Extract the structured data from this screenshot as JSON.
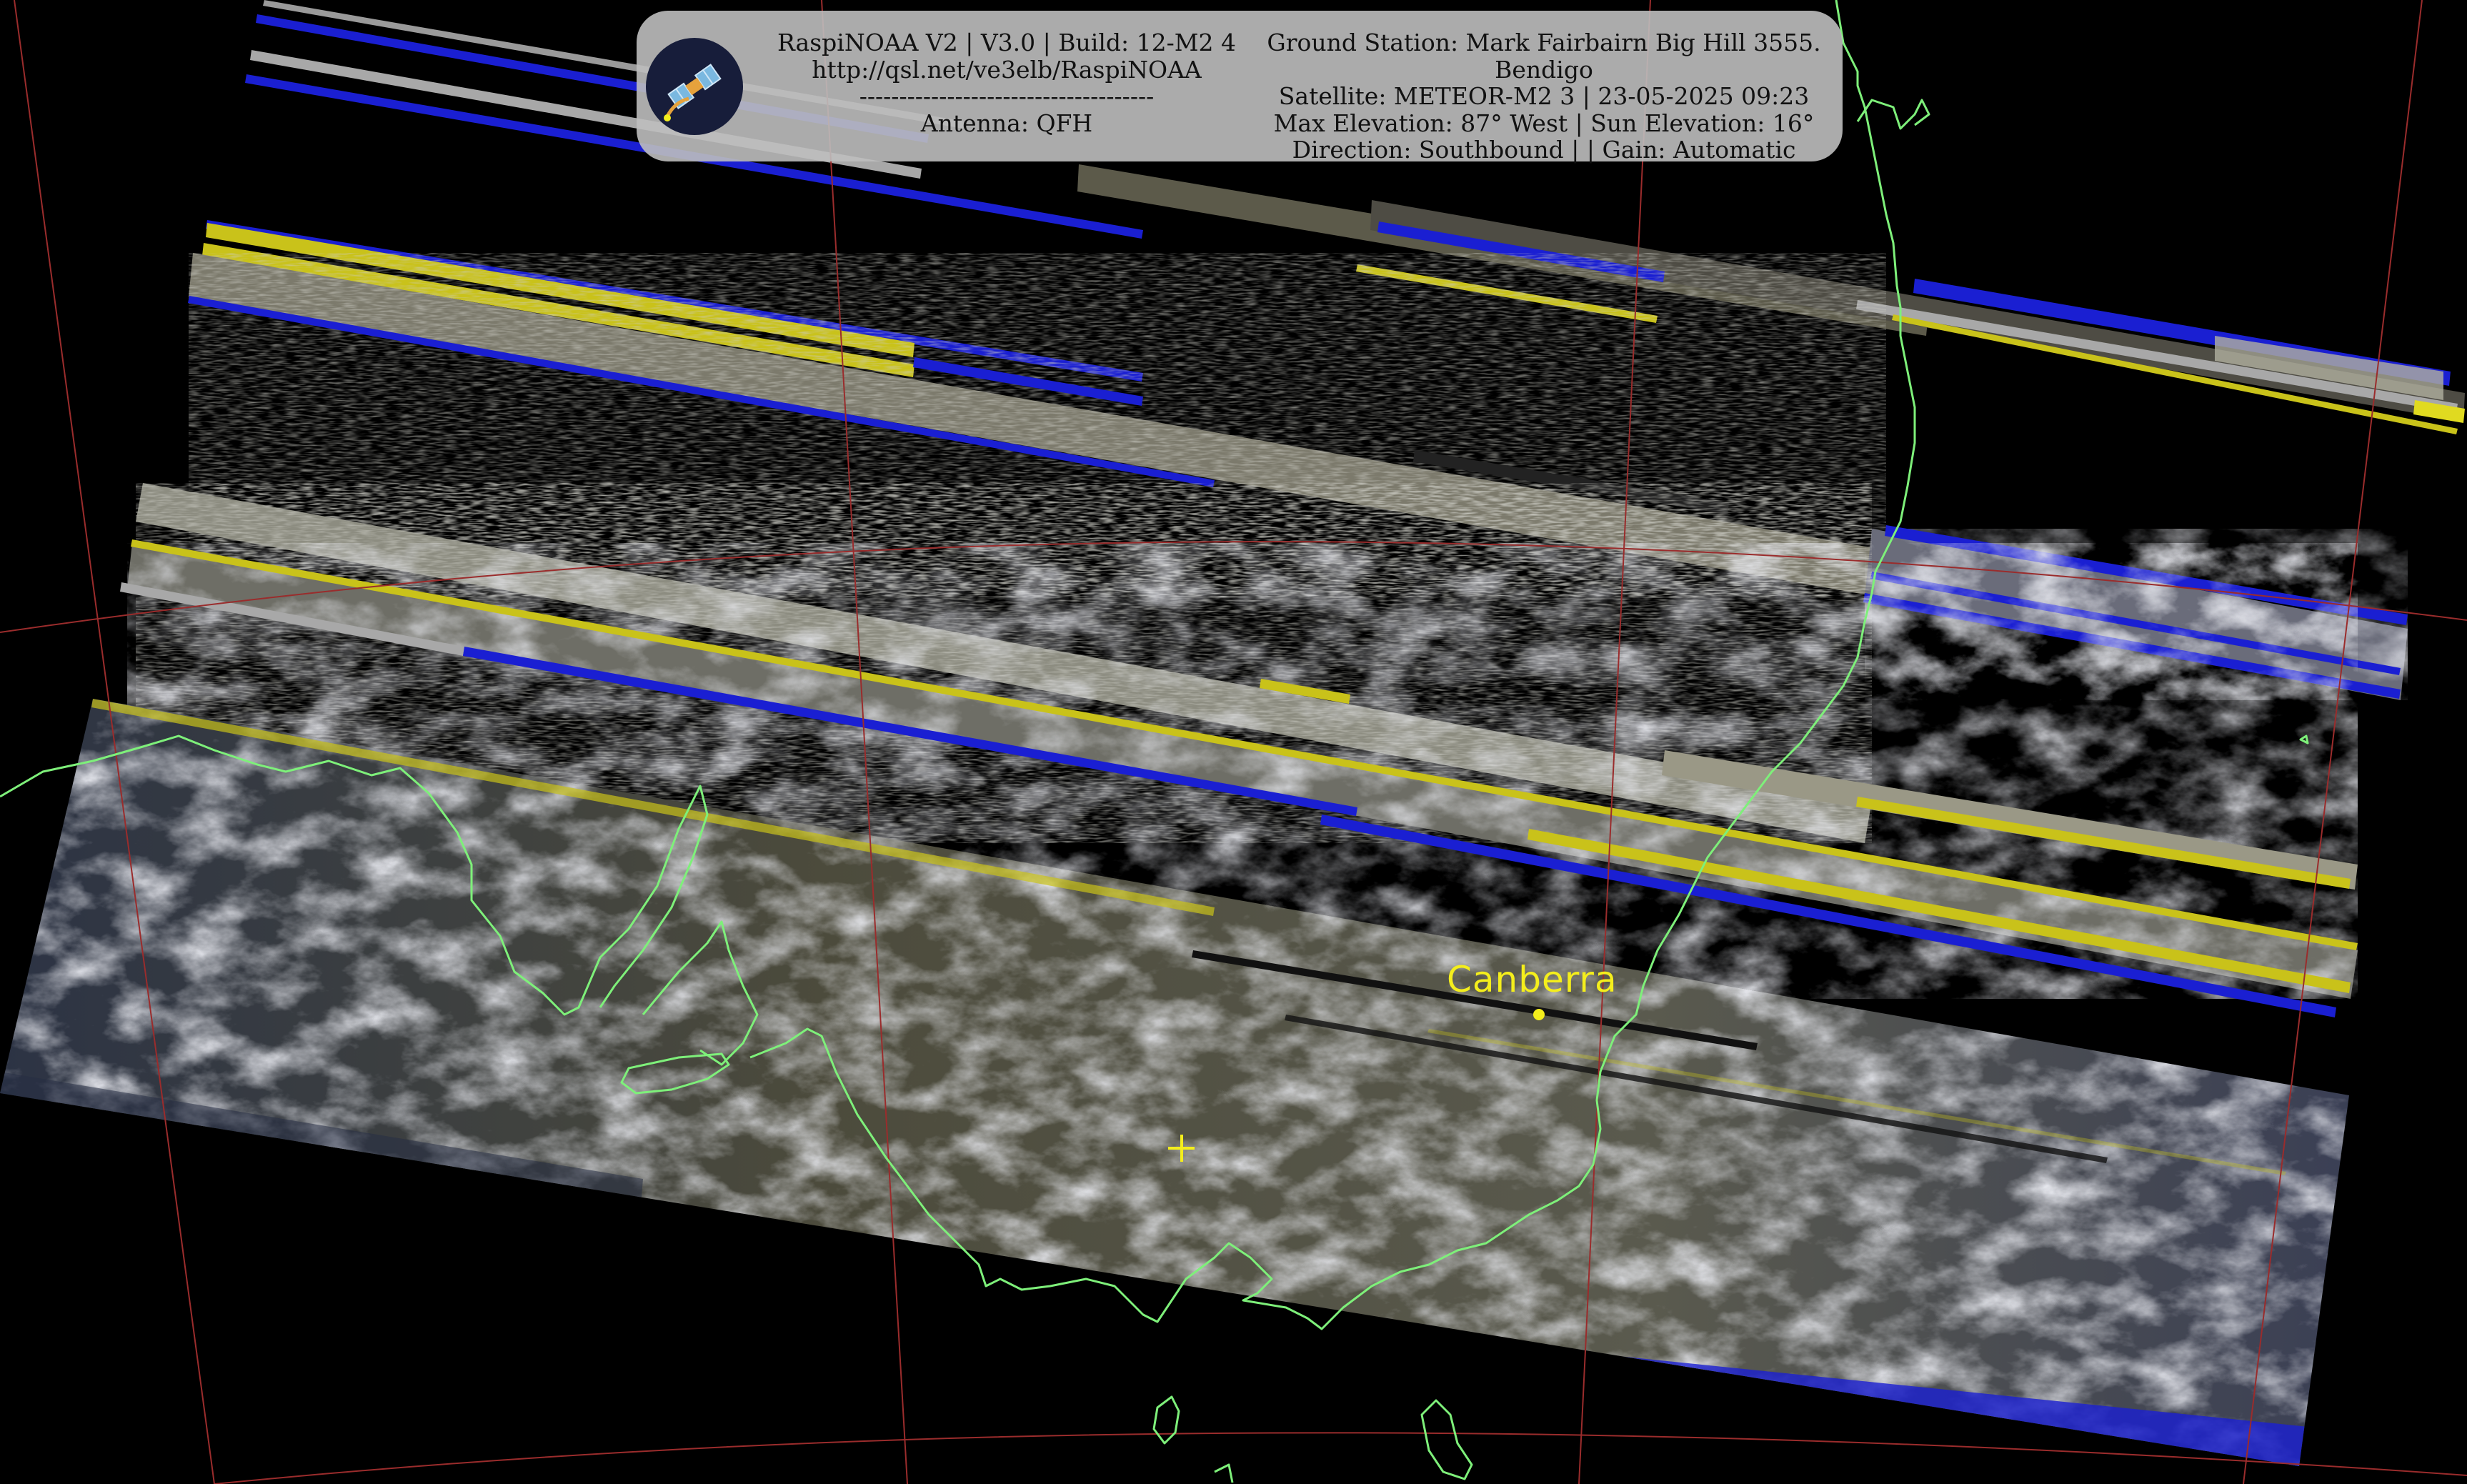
{
  "header": {
    "left_lines": [
      "RaspiNOAA V2 | V3.0 | Build: 12-M2 4",
      "http://qsl.net/ve3elb/RaspiNOAA",
      "-------------------------------------",
      "Antenna: QFH"
    ],
    "right_lines": [
      "Ground Station: Mark Fairbairn Big Hill 3555.",
      "Bendigo",
      "Satellite: METEOR-M2 3 | 23-05-2025 09:23",
      "Max Elevation: 87° West | Sun Elevation: 16°",
      "Direction: Southbound | | Gain: Automatic"
    ]
  },
  "map": {
    "city_label": "Canberra",
    "city_marker_color": "#f4ee1c",
    "station_marker_color": "#f4ee1c",
    "coastline_color": "#7ef07a",
    "grid_color": "#9a2c2c",
    "noise_stripe_colors": [
      "#c9c21a",
      "#1a1fd2",
      "#a8a8a8"
    ]
  },
  "icons": {
    "logo": "satellite-logo-icon",
    "station": "crosshair-icon",
    "city": "city-dot-icon"
  }
}
